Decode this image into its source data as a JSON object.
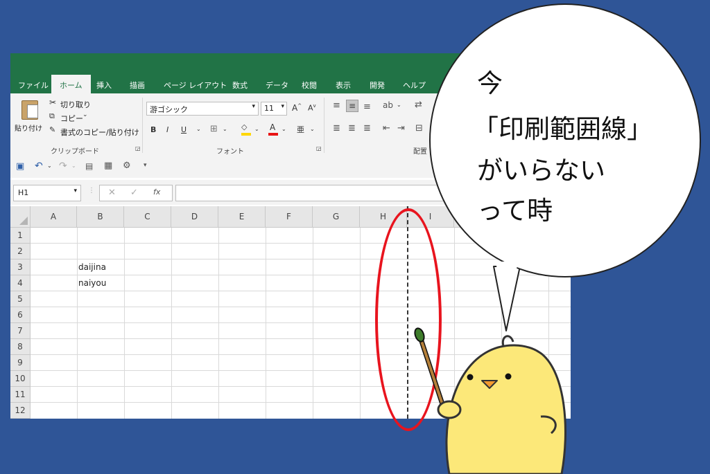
{
  "ribbon_tabs": [
    "ファイル",
    "ホーム",
    "挿入",
    "描画",
    "ページ レイアウト",
    "数式",
    "データ",
    "校閲",
    "表示",
    "開発",
    "ヘルプ"
  ],
  "clipboard": {
    "paste": "貼り付け",
    "cut": "切り取り",
    "copy": "コピー",
    "format_painter": "書式のコピー/貼り付け",
    "label": "クリップボード"
  },
  "font": {
    "name": "游ゴシック",
    "size": "11",
    "label": "フォント"
  },
  "alignment": {
    "label": "配置"
  },
  "formula_bar": {
    "name_box": "H1",
    "fx": "fx"
  },
  "columns": [
    "A",
    "B",
    "C",
    "D",
    "E",
    "F",
    "G",
    "H",
    "I"
  ],
  "rows": [
    "1",
    "2",
    "3",
    "4",
    "5",
    "6",
    "7",
    "8",
    "9",
    "10",
    "11",
    "12"
  ],
  "cells": {
    "b3": "daijina",
    "b4": "naiyou"
  },
  "speech": {
    "line1": "今",
    "line2": "「印刷範囲線」",
    "line3": "がいらない",
    "line4": "って時"
  },
  "colors": {
    "excel_green": "#217346",
    "background": "#2F5597",
    "highlight": "#E8141E"
  }
}
